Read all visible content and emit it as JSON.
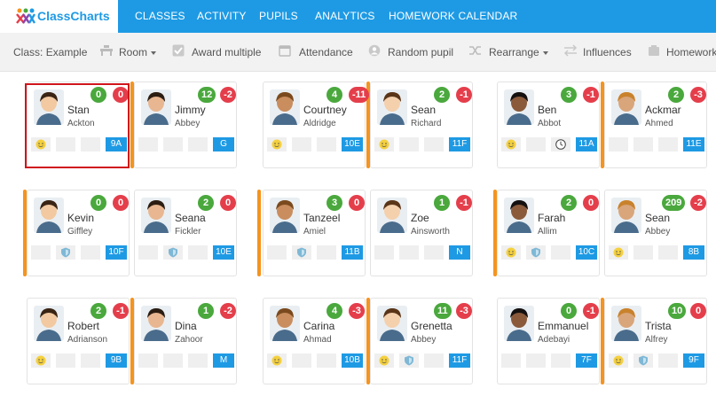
{
  "app": {
    "name": "ClassCharts"
  },
  "nav": {
    "items": [
      "CLASSES",
      "ACTIVITY",
      "PUPILS",
      "ANALYTICS",
      "HOMEWORK CALENDAR"
    ]
  },
  "toolbar": {
    "class_label": "Class:",
    "class_value": "Example",
    "room": "Room",
    "award_multiple": "Award multiple",
    "attendance": "Attendance",
    "random_pupil": "Random pupil",
    "rearrange": "Rearrange",
    "influences": "Influences",
    "homework": "Homework"
  },
  "colors": {
    "brand": "#1e9ae4",
    "positive": "#4aa83d",
    "negative": "#e53e4b",
    "desk_stripe": "#f5941e",
    "selection": "#d0151c"
  },
  "pupils": [
    {
      "first": "Stan",
      "last": "Ackton",
      "pos": "0",
      "neg": "0",
      "group": "9A",
      "icons": [
        "smile",
        "",
        ""
      ],
      "selected": true
    },
    {
      "first": "Jimmy",
      "last": "Abbey",
      "pos": "12",
      "neg": "-2",
      "group": "G",
      "icons": [
        "",
        "",
        ""
      ]
    },
    {
      "first": "Courtney",
      "last": "Aldridge",
      "pos": "4",
      "neg": "-11",
      "group": "10E",
      "icons": [
        "smile",
        "",
        ""
      ]
    },
    {
      "first": "Sean",
      "last": "Richard",
      "pos": "2",
      "neg": "-1",
      "group": "11F",
      "icons": [
        "smile",
        "",
        ""
      ]
    },
    {
      "first": "Ben",
      "last": "Abbot",
      "pos": "3",
      "neg": "-1",
      "group": "11A",
      "icons": [
        "smile",
        "",
        "clock"
      ]
    },
    {
      "first": "Ackmar",
      "last": "Ahmed",
      "pos": "2",
      "neg": "-3",
      "group": "11E",
      "icons": [
        "",
        "",
        ""
      ]
    },
    {
      "first": "Kevin",
      "last": "Giffley",
      "pos": "0",
      "neg": "0",
      "group": "10F",
      "icons": [
        "",
        "shield",
        ""
      ]
    },
    {
      "first": "Seana",
      "last": "Fickler",
      "pos": "2",
      "neg": "0",
      "group": "10E",
      "icons": [
        "",
        "shield",
        ""
      ]
    },
    {
      "first": "Tanzeel",
      "last": "Amiel",
      "pos": "3",
      "neg": "0",
      "group": "11B",
      "icons": [
        "",
        "shield",
        ""
      ]
    },
    {
      "first": "Zoe",
      "last": "Ainsworth",
      "pos": "1",
      "neg": "-1",
      "group": "N",
      "icons": [
        "",
        "",
        ""
      ]
    },
    {
      "first": "Farah",
      "last": "Allim",
      "pos": "2",
      "neg": "0",
      "group": "10C",
      "icons": [
        "smile",
        "shield",
        ""
      ]
    },
    {
      "first": "Sean",
      "last": "Abbey",
      "pos": "209",
      "neg": "-2",
      "group": "8B",
      "icons": [
        "smile",
        "",
        ""
      ]
    },
    {
      "first": "Robert",
      "last": "Adrianson",
      "pos": "2",
      "neg": "-1",
      "group": "9B",
      "icons": [
        "smile",
        "",
        ""
      ]
    },
    {
      "first": "Dina",
      "last": "Zahoor",
      "pos": "1",
      "neg": "-2",
      "group": "M",
      "icons": [
        "",
        "",
        ""
      ]
    },
    {
      "first": "Carina",
      "last": "Ahmad",
      "pos": "4",
      "neg": "-3",
      "group": "10B",
      "icons": [
        "smile",
        "",
        ""
      ]
    },
    {
      "first": "Grenetta",
      "last": "Abbey",
      "pos": "11",
      "neg": "-3",
      "group": "11F",
      "icons": [
        "smile",
        "shield",
        ""
      ]
    },
    {
      "first": "Emmanuel",
      "last": "Adebayi",
      "pos": "0",
      "neg": "-1",
      "group": "7F",
      "icons": [
        "",
        "",
        ""
      ]
    },
    {
      "first": "Trista",
      "last": "Alfrey",
      "pos": "10",
      "neg": "0",
      "group": "9F",
      "icons": [
        "smile",
        "shield",
        ""
      ]
    }
  ]
}
